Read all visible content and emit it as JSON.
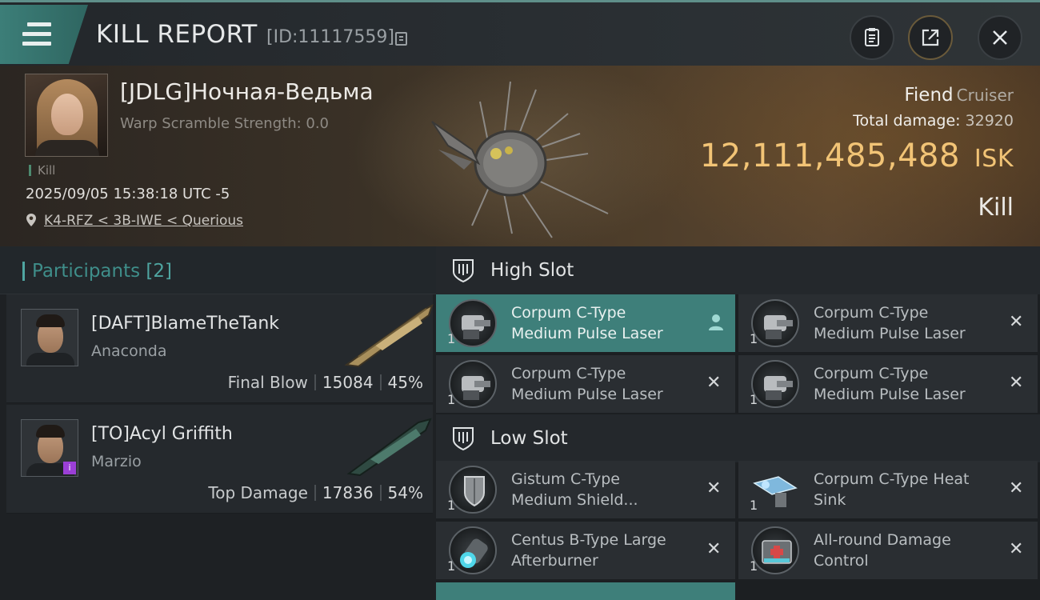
{
  "header": {
    "title": "KILL REPORT",
    "report_id": "[ID:11117559]",
    "icons": [
      "menu-icon",
      "copy-icon",
      "clipboard-icon",
      "share-icon",
      "close-icon"
    ]
  },
  "victim": {
    "name": "[JDLG]Ночная-Ведьма",
    "warp_scramble": "Warp Scramble Strength: 0.0",
    "tag": "Kill",
    "datetime": "2025/09/05 15:38:18 UTC -5",
    "location": "K4-RFZ < 3B-IWE < Querious",
    "ship_name": "Fiend",
    "ship_class": "Cruiser",
    "total_damage_label": "Total damage:",
    "total_damage": "32920",
    "isk_value": "12,111,485,488",
    "isk_unit": "ISK",
    "result": "Kill"
  },
  "participants": {
    "title": "Participants",
    "count": "[2]",
    "items": [
      {
        "name": "[DAFT]BlameTheTank",
        "ship": "Anaconda",
        "label": "Final Blow",
        "damage": "15084",
        "percent": "45%"
      },
      {
        "name": "[TO]Acyl Griffith",
        "ship": "Marzio",
        "label": "Top Damage",
        "damage": "17836",
        "percent": "54%"
      }
    ]
  },
  "fitting": {
    "high_slot": {
      "title": "High Slot",
      "modules": [
        {
          "name_line1": "Corpum C-Type",
          "name_line2": "Medium Pulse Laser",
          "qty": "1",
          "active": true
        },
        {
          "name_line1": "Corpum C-Type",
          "name_line2": "Medium Pulse Laser",
          "qty": "1",
          "active": false
        },
        {
          "name_line1": "Corpum C-Type",
          "name_line2": "Medium Pulse Laser",
          "qty": "1",
          "active": false
        },
        {
          "name_line1": "Corpum C-Type",
          "name_line2": "Medium Pulse Laser",
          "qty": "1",
          "active": false
        }
      ]
    },
    "low_slot": {
      "title": "Low Slot",
      "modules": [
        {
          "name_line1": "Gistum C-Type",
          "name_line2": "Medium Shield...",
          "qty": "1"
        },
        {
          "name_line1": "Corpum C-Type Heat",
          "name_line2": "Sink",
          "qty": "1"
        },
        {
          "name_line1": "Centus B-Type Large",
          "name_line2": "Afterburner",
          "qty": "1"
        },
        {
          "name_line1": "All-round Damage",
          "name_line2": "Control",
          "qty": "1"
        }
      ]
    }
  },
  "colors": {
    "accent_teal": "#3e7f7a",
    "isk_gold": "#f2c476",
    "participants_title": "#3f8e8a"
  }
}
